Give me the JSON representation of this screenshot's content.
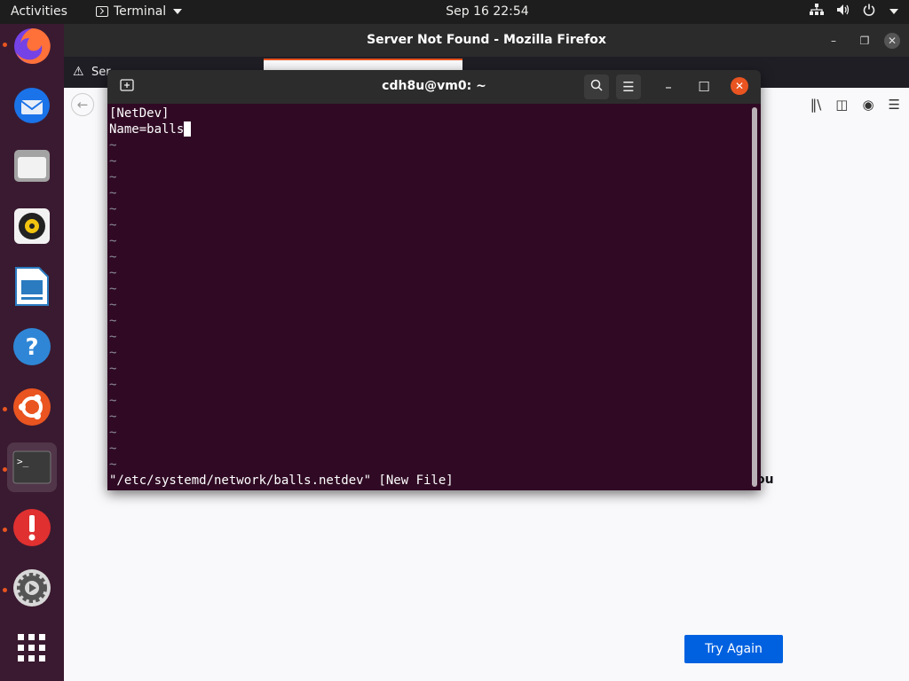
{
  "topbar": {
    "activities": "Activities",
    "app_name": "Terminal",
    "clock": "Sep 16  22:54"
  },
  "dock": {
    "items": [
      {
        "name": "firefox",
        "running": true
      },
      {
        "name": "thunderbird",
        "running": false
      },
      {
        "name": "files",
        "running": false
      },
      {
        "name": "rhythmbox",
        "running": false
      },
      {
        "name": "libreoffice-writer",
        "running": false
      },
      {
        "name": "help",
        "running": false
      },
      {
        "name": "ubuntu-software",
        "running": true
      },
      {
        "name": "terminal",
        "running": true
      },
      {
        "name": "software-updater",
        "running": true
      },
      {
        "name": "settings",
        "running": true
      },
      {
        "name": "show-applications",
        "running": false
      }
    ]
  },
  "firefox": {
    "window_title": "Server Not Found - Mozilla Firefox",
    "tab_label": "Ser",
    "content_partial_text": "ou",
    "try_again": "Try Again"
  },
  "terminal": {
    "title": "cdh8u@vm0: ~",
    "lines": [
      "[NetDev]",
      "Name=balls"
    ],
    "tilde_count": 21,
    "status_line": "\"/etc/systemd/network/balls.netdev\" [New File]"
  }
}
